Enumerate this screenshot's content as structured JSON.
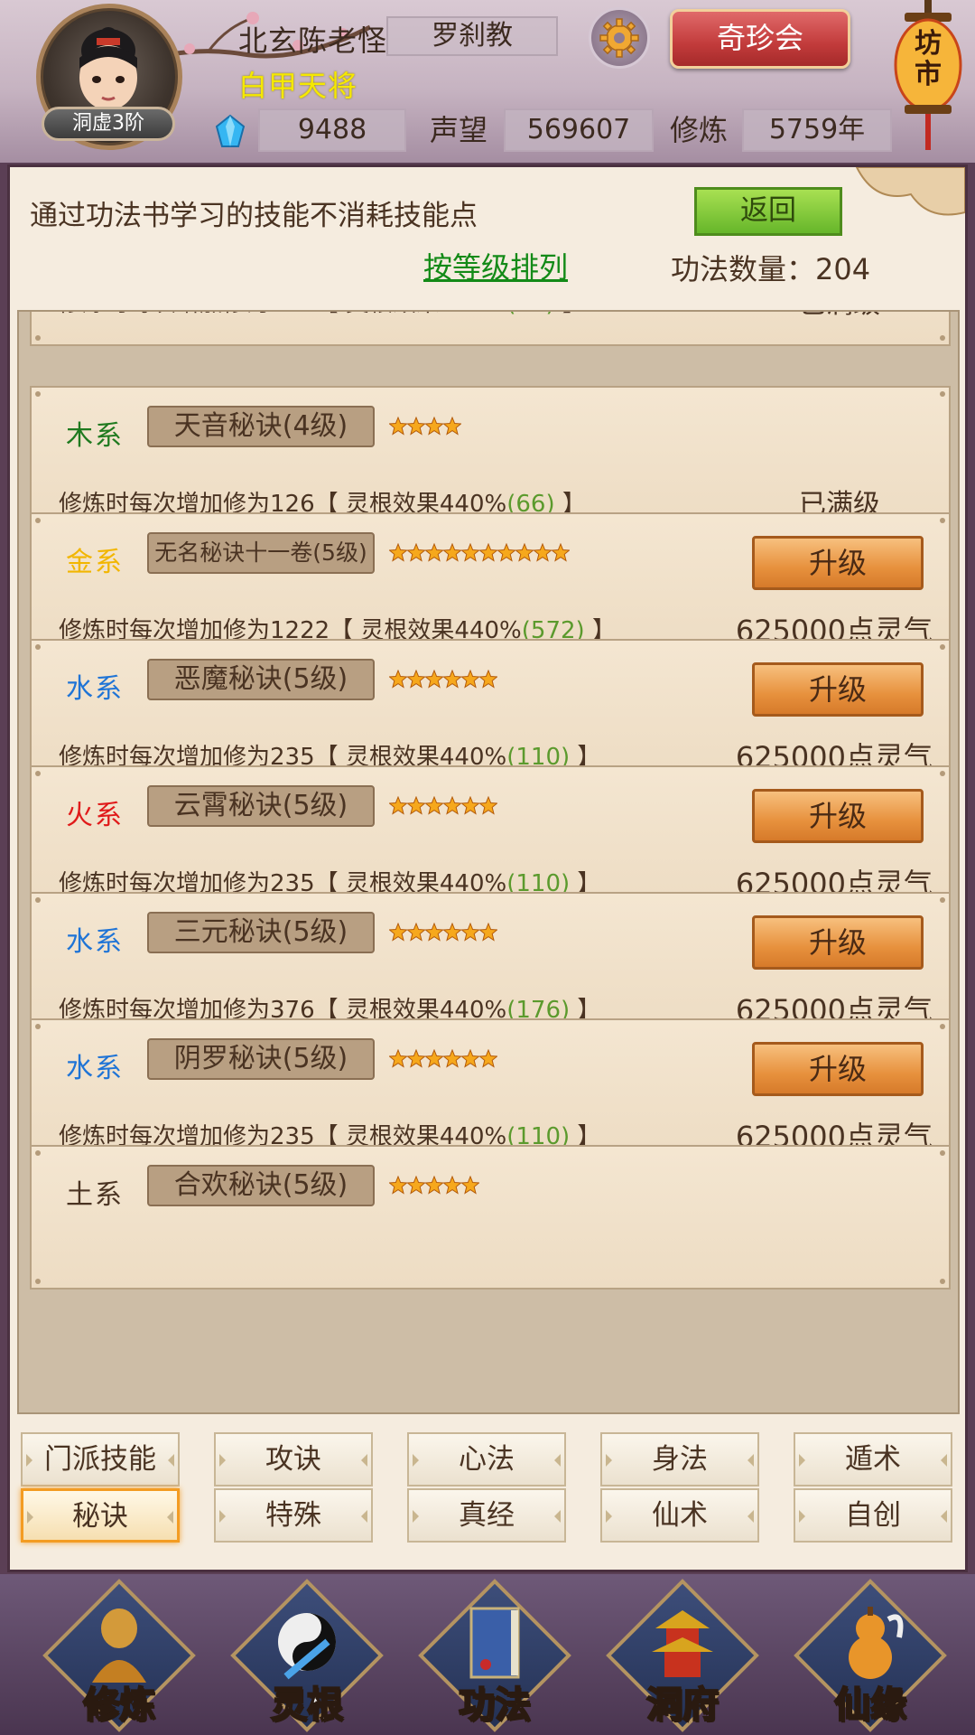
{
  "header": {
    "player_name": "北玄陈老怪",
    "sect": "罗刹教",
    "title": "白甲天将",
    "rank": "洞虚3阶",
    "gems": "9488",
    "reputation_label": "声望",
    "reputation": "569607",
    "cultivation_label": "修炼",
    "cultivation": "5759年",
    "treasure_button": "奇珍会",
    "market_lantern": "坊市"
  },
  "panel": {
    "notice": "通过功法书学习的技能不消耗技能点",
    "back_button": "返回",
    "sort_link": "按等级排列",
    "count_label": "功法数量：204"
  },
  "skills": [
    {
      "element": "",
      "element_color": "",
      "name": "",
      "stars": 0,
      "desc_prefix": "修炼时每次增加修为126【 灵根效果440%",
      "desc_value": "(66)",
      "desc_suffix": " 】",
      "status": "已满级",
      "cost": "",
      "button": ""
    },
    {
      "element": "木系",
      "element_color": "#1f7a1f",
      "name": "天音秘诀(4级)",
      "stars": 4,
      "desc_prefix": "修炼时每次增加修为126【 灵根效果440%",
      "desc_value": "(66)",
      "desc_suffix": " 】",
      "status": "已满级",
      "cost": "",
      "button": ""
    },
    {
      "element": "金系",
      "element_color": "#f2b600",
      "name": "无名秘诀十一卷(5级)",
      "stars": 10,
      "desc_prefix": "修炼时每次增加修为1222【 灵根效果440%",
      "desc_value": "(572)",
      "desc_suffix": " 】",
      "status": "",
      "cost": "625000点灵气",
      "button": "升级"
    },
    {
      "element": "水系",
      "element_color": "#1f74d6",
      "name": "恶魔秘诀(5级)",
      "stars": 6,
      "desc_prefix": "修炼时每次增加修为235【 灵根效果440%",
      "desc_value": "(110)",
      "desc_suffix": " 】",
      "status": "",
      "cost": "625000点灵气",
      "button": "升级"
    },
    {
      "element": "火系",
      "element_color": "#e01a1a",
      "name": "云霄秘诀(5级)",
      "stars": 6,
      "desc_prefix": "修炼时每次增加修为235【 灵根效果440%",
      "desc_value": "(110)",
      "desc_suffix": " 】",
      "status": "",
      "cost": "625000点灵气",
      "button": "升级"
    },
    {
      "element": "水系",
      "element_color": "#1f74d6",
      "name": "三元秘诀(5级)",
      "stars": 6,
      "desc_prefix": "修炼时每次增加修为376【 灵根效果440%",
      "desc_value": "(176)",
      "desc_suffix": " 】",
      "status": "",
      "cost": "625000点灵气",
      "button": "升级"
    },
    {
      "element": "水系",
      "element_color": "#1f74d6",
      "name": "阴罗秘诀(5级)",
      "stars": 6,
      "desc_prefix": "修炼时每次增加修为235【 灵根效果440%",
      "desc_value": "(110)",
      "desc_suffix": " 】",
      "status": "",
      "cost": "625000点灵气",
      "button": "升级"
    },
    {
      "element": "土系",
      "element_color": "#4a3322",
      "name": "合欢秘诀(5级)",
      "stars": 5,
      "desc_prefix": "",
      "desc_value": "",
      "desc_suffix": "",
      "status": "",
      "cost": "",
      "button": ""
    }
  ],
  "tabs": [
    {
      "label": "门派技能",
      "active": false
    },
    {
      "label": "攻诀",
      "active": false
    },
    {
      "label": "心法",
      "active": false
    },
    {
      "label": "身法",
      "active": false
    },
    {
      "label": "遁术",
      "active": false
    },
    {
      "label": "秘诀",
      "active": true
    },
    {
      "label": "特殊",
      "active": false
    },
    {
      "label": "真经",
      "active": false
    },
    {
      "label": "仙术",
      "active": false
    },
    {
      "label": "自创",
      "active": false
    }
  ],
  "nav": [
    {
      "label": "修炼",
      "icon": "monk-icon",
      "active": false
    },
    {
      "label": "灵根",
      "icon": "yinyang-sword-icon",
      "active": false
    },
    {
      "label": "功法",
      "icon": "book-icon",
      "active": true
    },
    {
      "label": "洞府",
      "icon": "pagoda-icon",
      "active": false
    },
    {
      "label": "仙缘",
      "icon": "gourd-icon",
      "active": false
    }
  ]
}
